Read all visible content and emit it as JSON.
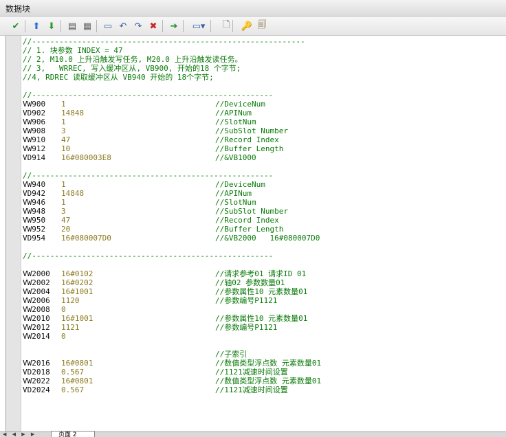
{
  "window": {
    "title": "数据块"
  },
  "toolbar": {
    "buttons": [
      {
        "name": "compile-icon",
        "glyph": "✔",
        "color": "#2e8b2e"
      },
      {
        "name": "arrow-up-icon",
        "glyph": "⬆",
        "color": "#2b6fd6"
      },
      {
        "name": "arrow-down-icon",
        "glyph": "⬇",
        "color": "#2a9a2a"
      },
      {
        "name": "insert-row-icon",
        "glyph": "▤",
        "color": "#555555"
      },
      {
        "name": "paste-icon",
        "glyph": "▦",
        "color": "#6a6a6a"
      },
      {
        "name": "rectangle-icon",
        "glyph": "▭",
        "color": "#3a5fa8"
      },
      {
        "name": "undo-icon",
        "glyph": "↶",
        "color": "#3a5fa8"
      },
      {
        "name": "redo-icon",
        "glyph": "↷",
        "color": "#3a5fa8"
      },
      {
        "name": "delete-icon",
        "glyph": "✖",
        "color": "#c62828"
      },
      {
        "name": "go-to-icon",
        "glyph": "➔",
        "color": "#2a8a2a"
      },
      {
        "name": "tag-dropdown-icon",
        "glyph": "▭▾",
        "color": "#3a5fa8"
      },
      {
        "name": "new-document-icon",
        "glyph": "🗋",
        "color": "#555555"
      },
      {
        "name": "key-icon",
        "glyph": "🔑",
        "color": "#c89a1a"
      },
      {
        "name": "properties-icon",
        "glyph": "🗐",
        "color": "#7a6a3a"
      }
    ]
  },
  "editor": {
    "lines": [
      {
        "row": 0,
        "segments": [
          {
            "col": 0,
            "cls": "cmt",
            "text": "//------------------------------------------------------------"
          }
        ]
      },
      {
        "row": 1,
        "segments": [
          {
            "col": 0,
            "cls": "cmt",
            "text": "// 1. 块参数 INDEX = 47"
          }
        ]
      },
      {
        "row": 2,
        "segments": [
          {
            "col": 0,
            "cls": "cmt",
            "text": "// 2, M10.0 上升沿触发写任务, M20.0 上升沿触发读任务。"
          }
        ]
      },
      {
        "row": 3,
        "segments": [
          {
            "col": 0,
            "cls": "cmt",
            "text": "// 3,   WRREC, 写入缓冲区从, VB900, 开始的18 个字节;"
          }
        ]
      },
      {
        "row": 4,
        "segments": [
          {
            "col": 0,
            "cls": "cmt",
            "text": "//4, RDREC 读取缓冲区从 VB940 开始的 18个字节;"
          }
        ]
      },
      {
        "row": 6,
        "segments": [
          {
            "col": 0,
            "cls": "cmt",
            "text": "//-----------------------------------------------------"
          }
        ]
      },
      {
        "row": 7,
        "segments": [
          {
            "col": 0,
            "cls": "addr",
            "text": "VW900"
          },
          {
            "col": 8,
            "cls": "val",
            "text": "1"
          },
          {
            "col": 40,
            "cls": "cmt",
            "text": "//DeviceNum"
          }
        ]
      },
      {
        "row": 8,
        "segments": [
          {
            "col": 0,
            "cls": "addr",
            "text": "VD902"
          },
          {
            "col": 8,
            "cls": "val",
            "text": "14848"
          },
          {
            "col": 40,
            "cls": "cmt",
            "text": "//APINum"
          }
        ]
      },
      {
        "row": 9,
        "segments": [
          {
            "col": 0,
            "cls": "addr",
            "text": "VW906"
          },
          {
            "col": 8,
            "cls": "val",
            "text": "1"
          },
          {
            "col": 40,
            "cls": "cmt",
            "text": "//SlotNum"
          }
        ]
      },
      {
        "row": 10,
        "segments": [
          {
            "col": 0,
            "cls": "addr",
            "text": "VW908"
          },
          {
            "col": 8,
            "cls": "val",
            "text": "3"
          },
          {
            "col": 40,
            "cls": "cmt",
            "text": "//SubSlot Number"
          }
        ]
      },
      {
        "row": 11,
        "segments": [
          {
            "col": 0,
            "cls": "addr",
            "text": "VW910"
          },
          {
            "col": 8,
            "cls": "val",
            "text": "47"
          },
          {
            "col": 40,
            "cls": "cmt",
            "text": "//Record Index"
          }
        ]
      },
      {
        "row": 12,
        "segments": [
          {
            "col": 0,
            "cls": "addr",
            "text": "VW912"
          },
          {
            "col": 8,
            "cls": "val",
            "text": "10"
          },
          {
            "col": 40,
            "cls": "cmt",
            "text": "//Buffer Length"
          }
        ]
      },
      {
        "row": 13,
        "segments": [
          {
            "col": 0,
            "cls": "addr",
            "text": "VD914"
          },
          {
            "col": 8,
            "cls": "val",
            "text": "16#080003E8"
          },
          {
            "col": 40,
            "cls": "cmt",
            "text": "//&VB1000"
          }
        ]
      },
      {
        "row": 15,
        "segments": [
          {
            "col": 0,
            "cls": "cmt",
            "text": "//-----------------------------------------------------"
          }
        ]
      },
      {
        "row": 16,
        "segments": [
          {
            "col": 0,
            "cls": "addr",
            "text": "VW940"
          },
          {
            "col": 8,
            "cls": "val",
            "text": "1"
          },
          {
            "col": 40,
            "cls": "cmt",
            "text": "//DeviceNum"
          }
        ]
      },
      {
        "row": 17,
        "segments": [
          {
            "col": 0,
            "cls": "addr",
            "text": "VD942"
          },
          {
            "col": 8,
            "cls": "val",
            "text": "14848"
          },
          {
            "col": 40,
            "cls": "cmt",
            "text": "//APINum"
          }
        ]
      },
      {
        "row": 18,
        "segments": [
          {
            "col": 0,
            "cls": "addr",
            "text": "VW946"
          },
          {
            "col": 8,
            "cls": "val",
            "text": "1"
          },
          {
            "col": 40,
            "cls": "cmt",
            "text": "//SlotNum"
          }
        ]
      },
      {
        "row": 19,
        "segments": [
          {
            "col": 0,
            "cls": "addr",
            "text": "VW948"
          },
          {
            "col": 8,
            "cls": "val",
            "text": "3"
          },
          {
            "col": 40,
            "cls": "cmt",
            "text": "//SubSlot Number"
          }
        ]
      },
      {
        "row": 20,
        "segments": [
          {
            "col": 0,
            "cls": "addr",
            "text": "VW950"
          },
          {
            "col": 8,
            "cls": "val",
            "text": "47"
          },
          {
            "col": 40,
            "cls": "cmt",
            "text": "//Record Index"
          }
        ]
      },
      {
        "row": 21,
        "segments": [
          {
            "col": 0,
            "cls": "addr",
            "text": "VW952"
          },
          {
            "col": 8,
            "cls": "val",
            "text": "20"
          },
          {
            "col": 40,
            "cls": "cmt",
            "text": "//Buffer Length"
          }
        ]
      },
      {
        "row": 22,
        "segments": [
          {
            "col": 0,
            "cls": "addr",
            "text": "VD954"
          },
          {
            "col": 8,
            "cls": "val",
            "text": "16#080007D0"
          },
          {
            "col": 40,
            "cls": "cmt",
            "text": "//&VB2000   16#080007D0"
          }
        ]
      },
      {
        "row": 24,
        "segments": [
          {
            "col": 0,
            "cls": "cmt",
            "text": "//-----------------------------------------------------"
          }
        ]
      },
      {
        "row": 26,
        "segments": [
          {
            "col": 0,
            "cls": "addr",
            "text": "VW2000"
          },
          {
            "col": 8,
            "cls": "val",
            "text": "16#0102"
          },
          {
            "col": 40,
            "cls": "cmt",
            "text": "//请求参考01 请求ID 01"
          }
        ]
      },
      {
        "row": 27,
        "segments": [
          {
            "col": 0,
            "cls": "addr",
            "text": "VW2002"
          },
          {
            "col": 8,
            "cls": "val",
            "text": "16#0202"
          },
          {
            "col": 40,
            "cls": "cmt",
            "text": "//轴02 参数数量01"
          }
        ]
      },
      {
        "row": 28,
        "segments": [
          {
            "col": 0,
            "cls": "addr",
            "text": "VW2004"
          },
          {
            "col": 8,
            "cls": "val",
            "text": "16#1001"
          },
          {
            "col": 40,
            "cls": "cmt",
            "text": "//参数属性10 元素数量01"
          }
        ]
      },
      {
        "row": 29,
        "segments": [
          {
            "col": 0,
            "cls": "addr",
            "text": "VW2006"
          },
          {
            "col": 8,
            "cls": "val",
            "text": "1120"
          },
          {
            "col": 40,
            "cls": "cmt",
            "text": "//参数编号P1121"
          }
        ]
      },
      {
        "row": 30,
        "segments": [
          {
            "col": 0,
            "cls": "addr",
            "text": "VW2008"
          },
          {
            "col": 8,
            "cls": "val",
            "text": "0"
          }
        ]
      },
      {
        "row": 31,
        "segments": [
          {
            "col": 0,
            "cls": "addr",
            "text": "VW2010"
          },
          {
            "col": 8,
            "cls": "val",
            "text": "16#1001"
          },
          {
            "col": 40,
            "cls": "cmt",
            "text": "//参数属性10 元素数量01"
          }
        ]
      },
      {
        "row": 32,
        "segments": [
          {
            "col": 0,
            "cls": "addr",
            "text": "VW2012"
          },
          {
            "col": 8,
            "cls": "val",
            "text": "1121"
          },
          {
            "col": 40,
            "cls": "cmt",
            "text": "//参数编号P1121"
          }
        ]
      },
      {
        "row": 33,
        "segments": [
          {
            "col": 0,
            "cls": "addr",
            "text": "VW2014"
          },
          {
            "col": 8,
            "cls": "val",
            "text": "0"
          }
        ]
      },
      {
        "row": 35,
        "segments": [
          {
            "col": 40,
            "cls": "cmt",
            "text": "//子索引"
          }
        ]
      },
      {
        "row": 36,
        "segments": [
          {
            "col": 0,
            "cls": "addr",
            "text": "VW2016"
          },
          {
            "col": 8,
            "cls": "val",
            "text": "16#0801"
          },
          {
            "col": 40,
            "cls": "cmt",
            "text": "//数值类型浮点数 元素数量01"
          }
        ]
      },
      {
        "row": 37,
        "segments": [
          {
            "col": 0,
            "cls": "addr",
            "text": "VD2018"
          },
          {
            "col": 8,
            "cls": "val",
            "text": "0.567"
          },
          {
            "col": 40,
            "cls": "cmt",
            "text": "//1121减速时间设置"
          }
        ]
      },
      {
        "row": 38,
        "segments": [
          {
            "col": 0,
            "cls": "addr",
            "text": "VW2022"
          },
          {
            "col": 8,
            "cls": "val",
            "text": "16#0801"
          },
          {
            "col": 40,
            "cls": "cmt",
            "text": "//数值类型浮点数 元素数量01"
          }
        ]
      },
      {
        "row": 39,
        "segments": [
          {
            "col": 0,
            "cls": "addr",
            "text": "VD2024"
          },
          {
            "col": 8,
            "cls": "val",
            "text": "0.567"
          },
          {
            "col": 40,
            "cls": "cmt",
            "text": "//1121减速时间设置"
          }
        ]
      }
    ]
  },
  "footer": {
    "tab_label": "页面 2",
    "nav": "◀ ◀ ▶ ▶"
  }
}
